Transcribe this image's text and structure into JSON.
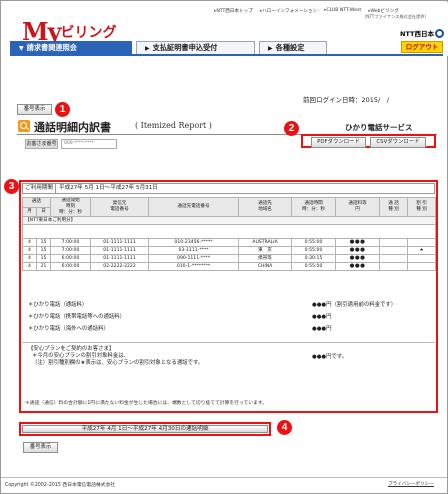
{
  "header": {
    "logo": {
      "latin": "My",
      "kana": "ビリング"
    },
    "top_links": [
      "NTT西日本トップ",
      "ハローインフォメーション",
      "CLUB NTT-West",
      "Webビリング"
    ],
    "top_link_sub": "（NTTファイナンス株式会社提供）",
    "brand": "NTT西日本",
    "tabs": [
      {
        "label": "請求書関連照会",
        "active": true
      },
      {
        "label": "支払証明書申込受付",
        "active": false
      },
      {
        "label": "各種設定",
        "active": false
      }
    ],
    "logout_label": "ログアウト"
  },
  "last_login": "前回ログイン日時：2015/　/",
  "number_display_label": "番号表示",
  "markers": [
    "1",
    "2",
    "3",
    "4"
  ],
  "title": {
    "main": "通話明細内訳書",
    "en": "( Itemized Report )",
    "service": "ひかり電話サービス"
  },
  "customer": {
    "label": "お客さま番号",
    "value": "000-****-****"
  },
  "downloads": {
    "pdf": "PDFダウンロード",
    "csv": "CSVダウンロード"
  },
  "period": {
    "label": "ご利用期間",
    "value": "平成27年 5月 1日～平成27年 5月31日"
  },
  "table": {
    "headers": {
      "date_group": "通話",
      "month": "月",
      "day": "日",
      "start": "通話開始\n時刻\n時：分：秒",
      "caller": "発信元\n電話番号",
      "dest_number": "通話先電話番号",
      "dest_area": "通話先\n地域名",
      "duration": "通話時間\n時：分：秒",
      "charge": "通話料等\n円",
      "type": "通 話\n種 別",
      "discount": "割 引\n種 別"
    },
    "group_label": "【NTT東日本ご利用分】",
    "rows": [
      {
        "month": "4",
        "day": "15",
        "start": "7:00:00",
        "caller": "01-1111-1111",
        "dest": "010-23456-*****",
        "area": "AUSTRALIA",
        "duration": "0:55:00",
        "charge": "●●●",
        "type": "",
        "discount": ""
      },
      {
        "month": "4",
        "day": "15",
        "start": "7:00:00",
        "caller": "01-1111-1111",
        "dest": "03-1111-****",
        "area": "東　京",
        "duration": "0:55:00",
        "charge": "●●●",
        "type": "",
        "discount": "★"
      },
      {
        "month": "4",
        "day": "15",
        "start": "6:00:00",
        "caller": "01-1111-1111",
        "dest": "090-1111-****",
        "area": "携帯等",
        "duration": "0:30:15",
        "charge": "●●●",
        "type": "",
        "discount": ""
      },
      {
        "month": "4",
        "day": "21",
        "start": "6:00:00",
        "caller": "02-2222-2222",
        "dest": "010-1-********",
        "area": "CHINA",
        "duration": "0:55:00",
        "charge": "●●●",
        "type": "",
        "discount": ""
      }
    ]
  },
  "summary": [
    {
      "label": "＊ひかり電話（通話料）",
      "amount": "●●●円（割引適用前の料金です）"
    },
    {
      "label": "＊ひかり電話（携帯電話等への通話料）",
      "amount": "●●●円"
    },
    {
      "label": "＊ひかり電話（海外への通話料）",
      "amount": "●●●円"
    }
  ],
  "plan_note": {
    "heading": "【安心プランをご契約のお客さま】",
    "line1": "＊今月の安心プランの割引対象料金は、",
    "line2": "（注）割引種別欄の★表示は、安心プランの割引対象となる通話です。",
    "amount": "●●●円です。"
  },
  "notice": "＊通話（通信）料の合計額に1円に満たない料金が生じた場合には、端数として切り捨てて計算を行っています。",
  "prev_period_button": "平成27年 4月 1日～平成27年 4月30日の通話明細",
  "footer": {
    "copyright": "Copyright ©2002-2015 西日本電信電話株式会社",
    "privacy": "プライバシーポリシー"
  }
}
